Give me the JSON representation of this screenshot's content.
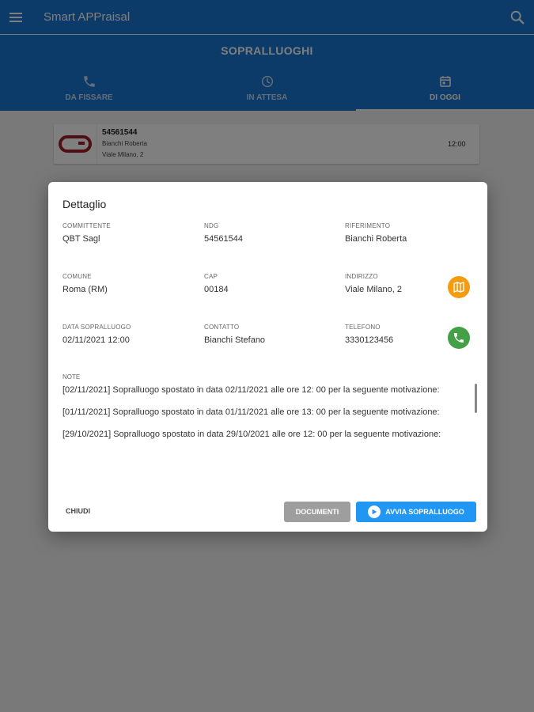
{
  "app": {
    "title": "Smart APPraisal"
  },
  "section": {
    "title": "SOPRALLUOGHI"
  },
  "tabs": [
    {
      "label": "DA FISSARE",
      "icon": "phone-icon"
    },
    {
      "label": "IN ATTESA",
      "icon": "clock-icon"
    },
    {
      "label": "DI OGGI",
      "icon": "calendar-icon",
      "active": true
    }
  ],
  "list": {
    "items": [
      {
        "ndg": "54561544",
        "name": "Bianchi Roberta",
        "address": "Viale Milano, 2",
        "time": "12:00"
      }
    ]
  },
  "dialog": {
    "title": "Dettaglio",
    "fields": {
      "committente": {
        "label": "COMMITTENTE",
        "value": "QBT Sagl"
      },
      "ndg": {
        "label": "NDG",
        "value": "54561544"
      },
      "riferimento": {
        "label": "RIFERIMENTO",
        "value": "Bianchi Roberta"
      },
      "comune": {
        "label": "COMUNE",
        "value": "Roma (RM)"
      },
      "cap": {
        "label": "CAP",
        "value": "00184"
      },
      "indirizzo": {
        "label": "INDIRIZZO",
        "value": "Viale Milano, 2"
      },
      "data": {
        "label": "DATA SOPRALLUOGO",
        "value": "02/11/2021 12:00"
      },
      "contatto": {
        "label": "CONTATTO",
        "value": "Bianchi Stefano"
      },
      "telefono": {
        "label": "TELEFONO",
        "value": "3330123456"
      }
    },
    "notes": {
      "label": "NOTE",
      "items": [
        "[02/11/2021] Sopralluogo spostato in data 02/11/2021 alle ore 12: 00 per la seguente motivazione:",
        "[01/11/2021] Sopralluogo spostato in data 01/11/2021 alle ore 13: 00 per la seguente motivazione:",
        "[29/10/2021] Sopralluogo spostato in data 29/10/2021 alle ore 12: 00 per la seguente motivazione:"
      ]
    },
    "buttons": {
      "close": "CHIUDI",
      "documents": "DOCUMENTI",
      "start": "AVVIA SOPRALLUOGO"
    }
  },
  "colors": {
    "primary": "#1976d2",
    "map_button": "#f39c12",
    "call_button": "#43a047",
    "start_button": "#2196f3"
  }
}
